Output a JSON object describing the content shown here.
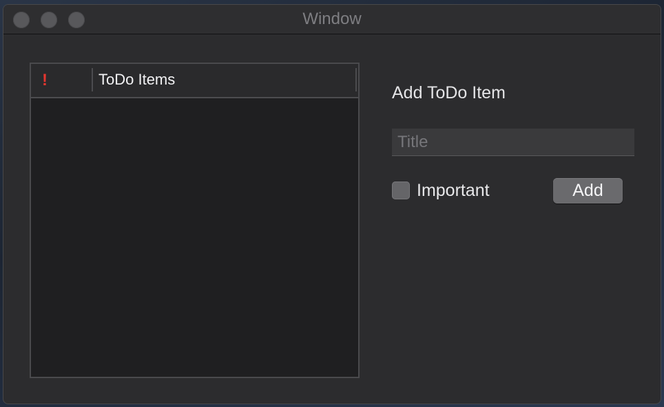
{
  "window": {
    "title": "Window"
  },
  "table": {
    "columns": [
      {
        "label": "!",
        "icon": "exclamation-icon",
        "color": "#e5362f"
      },
      {
        "label": "ToDo Items"
      }
    ],
    "rows": []
  },
  "form": {
    "heading": "Add ToDo Item",
    "title_input": {
      "value": "",
      "placeholder": "Title"
    },
    "important_checkbox": {
      "label": "Important",
      "checked": false
    },
    "add_button_label": "Add"
  }
}
